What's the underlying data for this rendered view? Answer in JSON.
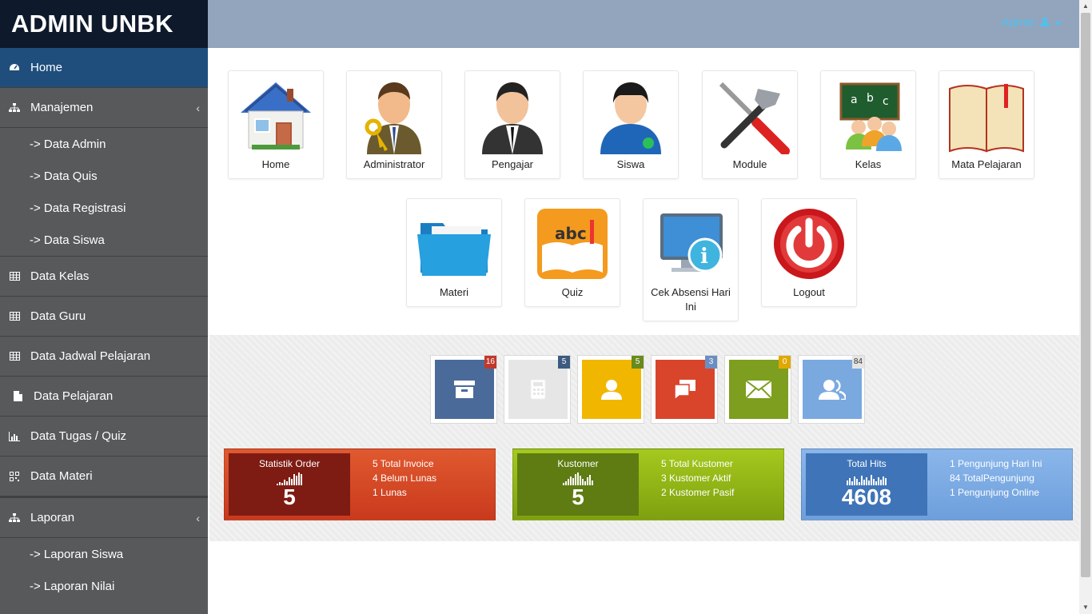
{
  "brand": "ADMIN UNBK",
  "user_menu": {
    "label": "Admin"
  },
  "sidebar": {
    "home": "Home",
    "manajemen": {
      "label": "Manajemen",
      "items": [
        "-> Data Admin",
        "-> Data Quis",
        "-> Data Registrasi",
        "-> Data Siswa"
      ]
    },
    "data_kelas": "Data Kelas",
    "data_guru": "Data Guru",
    "data_jadwal": "Data Jadwal Pelajaran",
    "data_pelajaran": "Data Pelajaran",
    "data_tugas": "Data Tugas / Quiz",
    "data_materi": "Data Materi",
    "laporan": {
      "label": "Laporan",
      "items": [
        "-> Laporan Siswa",
        "-> Laporan Nilai"
      ]
    }
  },
  "tiles": {
    "home": "Home",
    "administrator": "Administrator",
    "pengajar": "Pengajar",
    "siswa": "Siswa",
    "module": "Module",
    "kelas": "Kelas",
    "mata_pelajaran": "Mata Pelajaran",
    "materi": "Materi",
    "quiz": "Quiz",
    "cek_absensi": "Cek Absensi Hari Ini",
    "logout": "Logout"
  },
  "quick_squares": [
    {
      "icon": "archive-icon",
      "badge": "16",
      "color": "#4a6b99",
      "badge_color": "#c0392b"
    },
    {
      "icon": "calculator-icon",
      "badge": "5",
      "color": "#e6e6e6",
      "badge_color": "#3d5a80"
    },
    {
      "icon": "user-icon",
      "badge": "5",
      "color": "#f1b700",
      "badge_color": "#6a8a1c"
    },
    {
      "icon": "chat-icon",
      "badge": "3",
      "color": "#d9452b",
      "badge_color": "#6b8ec2"
    },
    {
      "icon": "envelope-icon",
      "badge": "0",
      "color": "#7d9e1e",
      "badge_color": "#e0a800"
    },
    {
      "icon": "users-icon",
      "badge": "84",
      "color": "#7aa9e0",
      "badge_color": "#e5e5e5"
    }
  ],
  "stats": {
    "order": {
      "title": "Statistik Order",
      "value": "5",
      "lines": [
        "5 Total Invoice",
        "4 Belum Lunas",
        "1 Lunas"
      ]
    },
    "kustomer": {
      "title": "Kustomer",
      "value": "5",
      "lines": [
        "5 Total Kustomer",
        "3 Kustomer Aktif",
        "2 Kustomer Pasif"
      ]
    },
    "hits": {
      "title": "Total Hits",
      "value": "4608",
      "lines": [
        "1 Pengunjung Hari Ini",
        "84 TotalPengunjung",
        "1 Pengunjung Online"
      ]
    }
  },
  "colors": {
    "sidebar": "#58595b",
    "sidebar_active": "#1f4e7d",
    "brand_bg": "#0e1a2b",
    "topbar": "#92a5bd",
    "user_link": "#4fc1f0"
  }
}
